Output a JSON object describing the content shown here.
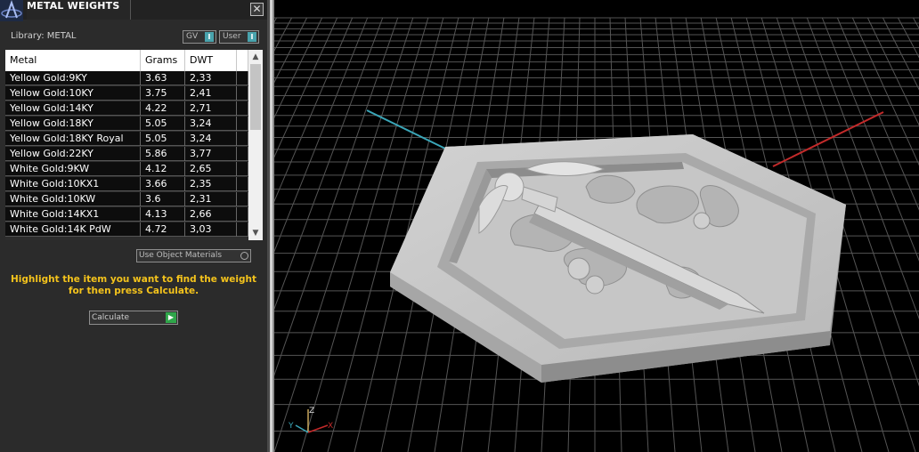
{
  "panel": {
    "title": "METAL WEIGHTS",
    "close_glyph": "✕",
    "library_label": "Library: METAL",
    "toggles": [
      {
        "label": "GV",
        "value": "I"
      },
      {
        "label": "User",
        "value": "I"
      }
    ],
    "table": {
      "headers": [
        "Metal",
        "Grams",
        "DWT"
      ],
      "rows": [
        {
          "metal": "Yellow Gold:9KY",
          "grams": "3.63",
          "dwt": "2,33"
        },
        {
          "metal": "Yellow Gold:10KY",
          "grams": "3.75",
          "dwt": "2,41"
        },
        {
          "metal": "Yellow Gold:14KY",
          "grams": "4.22",
          "dwt": "2,71"
        },
        {
          "metal": "Yellow Gold:18KY",
          "grams": "5.05",
          "dwt": "3,24"
        },
        {
          "metal": "Yellow Gold:18KY Royal",
          "grams": "5.05",
          "dwt": "3,24"
        },
        {
          "metal": "Yellow Gold:22KY",
          "grams": "5.86",
          "dwt": "3,77"
        },
        {
          "metal": "White Gold:9KW",
          "grams": "4.12",
          "dwt": "2,65"
        },
        {
          "metal": "White Gold:10KX1",
          "grams": "3.66",
          "dwt": "2,35"
        },
        {
          "metal": "White Gold:10KW",
          "grams": "3.6",
          "dwt": "2,31"
        },
        {
          "metal": "White Gold:14KX1",
          "grams": "4.13",
          "dwt": "2,66"
        },
        {
          "metal": "White Gold:14K PdW",
          "grams": "4.72",
          "dwt": "3,03"
        }
      ]
    },
    "use_object_materials": "Use Object Materials",
    "instructions": "Highlight the item you want to find the weight for then press Calculate.",
    "calculate_label": "Calculate"
  },
  "viewport": {
    "axis_labels": {
      "x": "X",
      "y": "Y",
      "z": "Z"
    }
  },
  "colors": {
    "accent": "#49a3ad",
    "instruction_text": "#f4c31c",
    "go_button": "#2fa64a",
    "x_axis": "#c32a2a",
    "y_axis": "#3aa6b8"
  }
}
